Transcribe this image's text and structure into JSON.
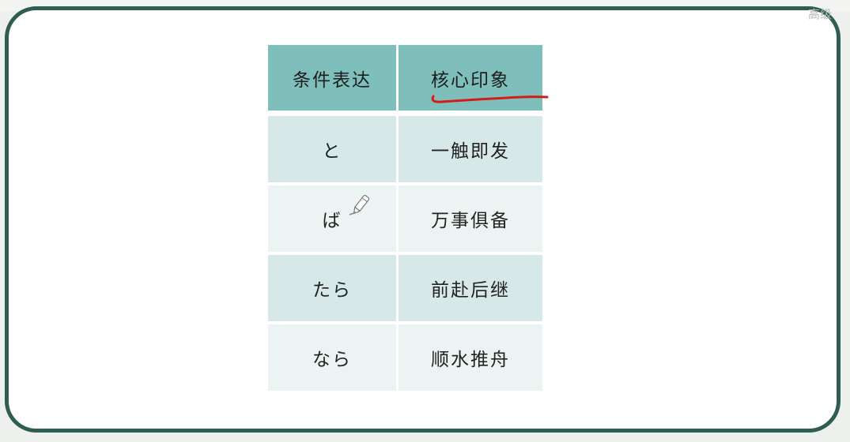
{
  "corner_text": "高级",
  "table": {
    "header": [
      "条件表达",
      "核心印象"
    ],
    "rows": [
      [
        "と",
        "一触即发"
      ],
      [
        "ば",
        "万事俱备"
      ],
      [
        "たら",
        "前赴后继"
      ],
      [
        "なら",
        "顺水推舟"
      ]
    ]
  },
  "colors": {
    "header_bg": "#7ebfbb",
    "row_dark": "#d6e8e7",
    "row_light": "#ecf4f3",
    "frame": "#2f5d52",
    "annotation": "#d51a1a"
  },
  "icons": [
    "pen-cursor-icon"
  ]
}
